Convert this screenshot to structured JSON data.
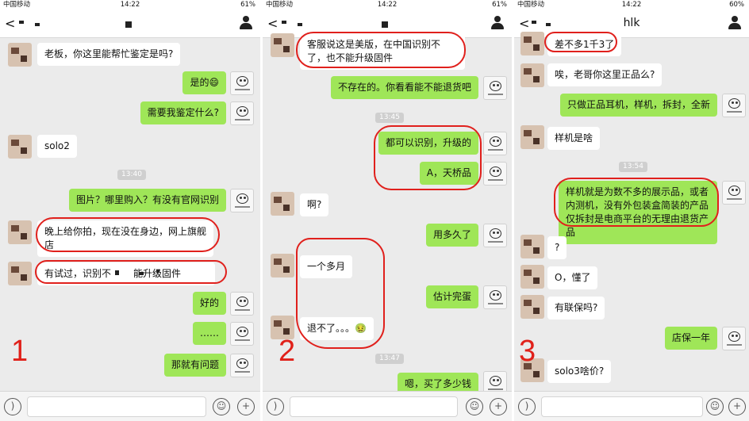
{
  "colors": {
    "bubble_out": "#9fe658",
    "bubble_in": "#ffffff",
    "chat_bg": "#ebebeb",
    "annotation_red": "#e0201c"
  },
  "panels": [
    {
      "status": {
        "carrier": "中国移动",
        "time": "14:22",
        "battery": "61%"
      },
      "nav": {
        "back": "<",
        "title": "",
        "user_icon": "person-icon"
      },
      "messages": [
        {
          "text": "老板，你这里能帮忙鉴定是吗?"
        },
        {
          "text": "是的😄"
        },
        {
          "text": "需要我鉴定什么?"
        },
        {
          "text": "solo2"
        },
        {
          "text": "图片？哪里购入？有没有官网识别"
        },
        {
          "text": "晚上给你拍，现在没在身边，网上旗舰店"
        },
        {
          "text": "有试过，识别不",
          "text2": "能升级固件"
        },
        {
          "text": "好的"
        },
        {
          "text": "……"
        },
        {
          "text": "那就有问题"
        }
      ],
      "timestamps": [
        "13:40"
      ],
      "marker": "1"
    },
    {
      "status": {
        "carrier": "中国移动",
        "time": "14:22",
        "battery": "61%"
      },
      "nav": {
        "back": "<",
        "title": "",
        "user_icon": "person-icon"
      },
      "messages": [
        {
          "text": "客服说这是美版，在中国识别不了，也不能升级固件"
        },
        {
          "text": "不存在的。你看看能不能退货吧"
        },
        {
          "text": "都可以识别，升级的"
        },
        {
          "text": "A，天桥品"
        },
        {
          "text": "啊?"
        },
        {
          "text": "用多久了"
        },
        {
          "text": "一个多月"
        },
        {
          "text": "估计完蛋"
        },
        {
          "text": "退不了。。。🤢"
        },
        {
          "text": "嗯，买了多少钱"
        }
      ],
      "timestamps": [
        "13:45",
        "13:47"
      ],
      "marker": "2"
    },
    {
      "status": {
        "carrier": "中国移动",
        "time": "14:22",
        "battery": "60%"
      },
      "nav": {
        "back": "<",
        "title": "hlk",
        "user_icon": "person-icon"
      },
      "messages": [
        {
          "text": "差不多1千3了"
        },
        {
          "text": "唉，老哥你这里正品么?"
        },
        {
          "text": "只做正品耳机，样机，拆封，全新"
        },
        {
          "text": "样机是啥"
        },
        {
          "text": "样机就是为数不多的展示品，或者内测机，没有外包装盒简装的产品 仅拆封是电商平台的无理由退货产品"
        },
        {
          "text": "?"
        },
        {
          "text": "O，懂了"
        },
        {
          "text": "有联保吗?"
        },
        {
          "text": "店保一年"
        },
        {
          "text": "solo3啥价?"
        }
      ],
      "timestamps": [
        "13:54"
      ],
      "marker": "3"
    }
  ],
  "input_bar": {
    "voice_icon": "voice-icon",
    "emoji_icon": "emoji-icon",
    "plus_icon": "plus-icon"
  }
}
